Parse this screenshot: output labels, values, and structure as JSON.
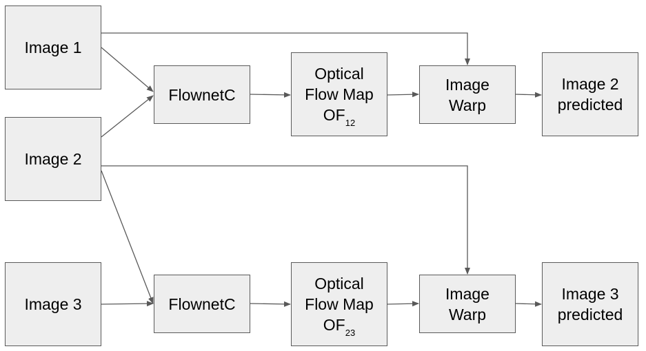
{
  "nodes": {
    "image1": "Image 1",
    "image2": "Image 2",
    "image3": "Image 3",
    "flownet_top": "FlownetC",
    "flownet_bottom": "FlownetC",
    "optical_top": {
      "line1": "Optical",
      "line2": "Flow Map",
      "line3": "OF",
      "sub": "12"
    },
    "optical_bottom": {
      "line1": "Optical",
      "line2": "Flow Map",
      "line3": "OF",
      "sub": "23"
    },
    "warp_top": {
      "line1": "Image",
      "line2": "Warp"
    },
    "warp_bottom": {
      "line1": "Image",
      "line2": "Warp"
    },
    "pred_top": {
      "line1": "Image 2",
      "line2": "predicted"
    },
    "pred_bottom": {
      "line1": "Image 3",
      "line2": "predicted"
    }
  },
  "colors": {
    "fill": "#eeeeee",
    "stroke": "#595959"
  }
}
